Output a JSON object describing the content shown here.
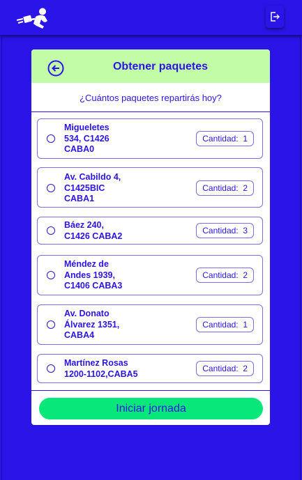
{
  "header": {
    "logo_icon": "runner-with-package-icon",
    "logout_icon": "logout-icon"
  },
  "card": {
    "title": "Obtener paquetes",
    "back_icon": "arrow-left-circle-icon",
    "subtitle": "¿Cuántos paquetes repartirás hoy?",
    "quantity_label": "Cantidad:",
    "items": [
      {
        "line1": "Migueletes",
        "line2": "534, C1426",
        "line3": "CABA0",
        "qty": "1",
        "checked": false
      },
      {
        "line1": "Av. Cabildo 4,",
        "line2": "C1425BIC",
        "line3": "CABA1",
        "qty": "2",
        "checked": false
      },
      {
        "line1": "Báez 240,",
        "line2": "C1426 CABA2",
        "line3": "",
        "qty": "3",
        "checked": false
      },
      {
        "line1": "Méndez de",
        "line2": "Andes 1939,",
        "line3": "C1406 CABA3",
        "qty": "2",
        "checked": false
      },
      {
        "line1": "Av. Donato",
        "line2": "Álvarez 1351,",
        "line3": "CABA4",
        "qty": "1",
        "checked": false
      },
      {
        "line1": "Martínez Rosas",
        "line2": "1200-1102,CABA5",
        "line3": "",
        "qty": "2",
        "checked": false
      }
    ],
    "start_button": "Iniciar jornada"
  },
  "colors": {
    "primary": "#2b14e8",
    "header_bg": "#c3fca6",
    "button": "#07e77a",
    "border": "#7b6ee8"
  }
}
